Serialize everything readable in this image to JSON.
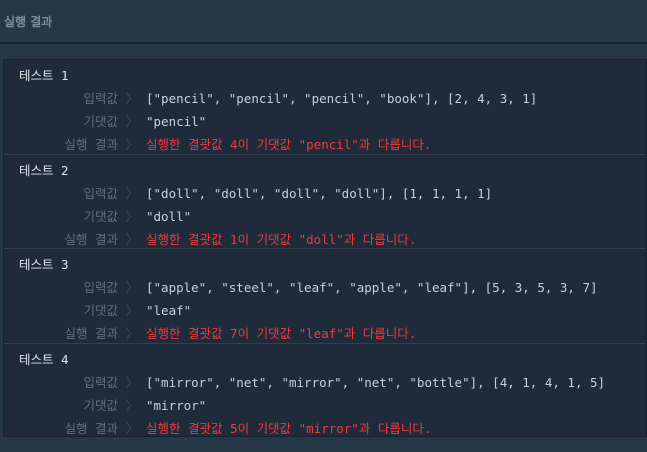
{
  "header": {
    "title": "실행 결과"
  },
  "labels": {
    "input": "입력값",
    "expected": "기댓값",
    "result": "실행 결과",
    "chevron": "〉"
  },
  "colors": {
    "error": "#f03b3b"
  },
  "tests": [
    {
      "title": "테스트 1",
      "input": "[\"pencil\", \"pencil\", \"pencil\", \"book\"], [2, 4, 3, 1]",
      "expected": "\"pencil\"",
      "result": "실행한 결괏값 4이 기댓값 \"pencil\"과 다릅니다."
    },
    {
      "title": "테스트 2",
      "input": "[\"doll\", \"doll\", \"doll\", \"doll\"], [1, 1, 1, 1]",
      "expected": "\"doll\"",
      "result": "실행한 결괏값 1이 기댓값 \"doll\"과 다릅니다."
    },
    {
      "title": "테스트 3",
      "input": "[\"apple\", \"steel\", \"leaf\", \"apple\", \"leaf\"], [5, 3, 5, 3, 7]",
      "expected": "\"leaf\"",
      "result": "실행한 결괏값 7이 기댓값 \"leaf\"과 다릅니다."
    },
    {
      "title": "테스트 4",
      "input": "[\"mirror\", \"net\", \"mirror\", \"net\", \"bottle\"], [4, 1, 4, 1, 5]",
      "expected": "\"mirror\"",
      "result": "실행한 결괏값 5이 기댓값 \"mirror\"과 다릅니다."
    }
  ]
}
